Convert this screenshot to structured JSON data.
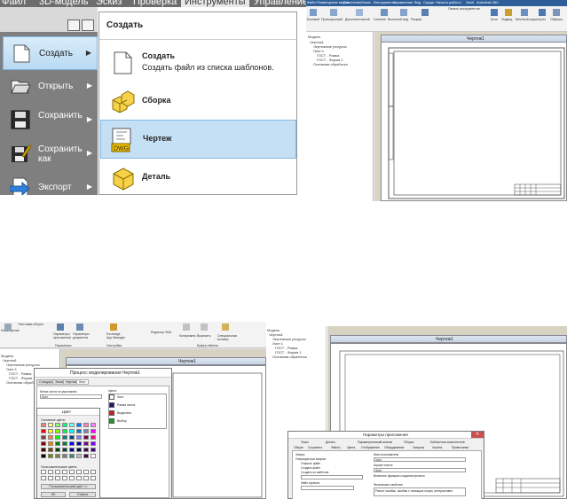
{
  "panel1": {
    "ribbon_tabs": [
      "Файл",
      "3D-модель",
      "Эскиз",
      "Проверка",
      "Инструменты",
      "Управление"
    ],
    "active_tab": "Инструменты",
    "file_menu": [
      {
        "label": "Создать",
        "selected": true
      },
      {
        "label": "Открыть",
        "selected": false
      },
      {
        "label": "Сохранить",
        "selected": false
      },
      {
        "label": "Сохранить как",
        "selected": false
      },
      {
        "label": "Экспорт",
        "selected": false
      }
    ],
    "submenu_title": "Создать",
    "submenu_items": [
      {
        "title": "Создать",
        "desc": "Создать файл из списка шаблонов."
      },
      {
        "title": "Сборка",
        "desc": ""
      },
      {
        "title": "Чертеж",
        "desc": "",
        "selected": true
      },
      {
        "title": "Деталь",
        "desc": ""
      }
    ],
    "dwg_badge": "DWG"
  },
  "panel2": {
    "tabs": [
      "Файл",
      "Размещение видов",
      "Пояснения",
      "Эскиз",
      "Инструменты",
      "Управление",
      "Вид",
      "Среда",
      "Начало работы",
      "Vault",
      "Autodesk 360"
    ],
    "ribbon_labels": [
      "Базовый",
      "Проекционный",
      "Дополнительный",
      "Сечение",
      "Выносной вид",
      "Разрыв",
      "Панель инструментов",
      "Блок",
      "Подвид",
      "Местный разрез",
      "Срез",
      "Обрезка"
    ],
    "browser_items": [
      "Модель",
      "Чертеж1",
      "Чертежные ресурсы",
      "Лист:1",
      "ГОСТ - Рамка",
      "ГОСТ - Форма 1",
      "Основная обработка"
    ],
    "sheet_title": "Чертеж1"
  },
  "panel3": {
    "ribbon_labels": [
      "Размещение",
      "Текстовая сборка",
      "Параметры приложения",
      "Параметры документа",
      "Exchange App Manager",
      "Редактор VBA",
      "Копировать",
      "Вырезать",
      "Специальная вставка",
      "Параметры",
      "Настройка",
      "Буфер обмена"
    ],
    "browser_items": [
      "Модель",
      "Чертеж1",
      "Чертежные ресурсы",
      "Лист:1",
      "ГОСТ - Рамка",
      "ГОСТ - Форма 1",
      "Основная обработка"
    ],
    "sheet_title": "Чертеж1",
    "dialog_title": "Процесс моделирования Чертеж1",
    "dialog_tabs": [
      "Стандарт",
      "Эскиз",
      "Чертеж",
      "Лист"
    ],
    "field_label": "Метка листа по умолчанию",
    "field_value": "Лист",
    "colors_header": "Цвета",
    "colors": [
      {
        "name": "Лист",
        "hex": "#ffffff"
      },
      {
        "name": "Рамка листа",
        "hex": "#1a1a6e"
      },
      {
        "name": "Выделить",
        "hex": "#d01f1f"
      },
      {
        "name": "Выбор",
        "hex": "#1f9e2a"
      }
    ],
    "color_dialog_title": "Цвет",
    "basic_colors_label": "Основные цвета:",
    "custom_colors_label": "Пользовательские цвета:",
    "define_button": "Пользовательский цвет >>",
    "ok_button": "ОК",
    "cancel_button": "Отмена"
  },
  "panel4": {
    "browser_items": [
      "Модель",
      "Чертеж1",
      "Чертежные ресурсы",
      "Лист:1",
      "ГОСТ - Рамка",
      "ГОСТ - Форма 1",
      "Основная обработка"
    ],
    "sheet_title": "Чертеж1",
    "dialog_title": "Параметры приложения",
    "tabs_row1": [
      "Эскиз",
      "Деталь",
      "Параметрический анализ",
      "Сборка",
      "Библиотека компонентов"
    ],
    "tabs_row2": [
      "Общие",
      "Сохранить",
      "Файлы",
      "Цвета",
      "Отображение",
      "Оборудование",
      "Запросы",
      "Чертеж",
      "Примечания"
    ],
    "left_labels": [
      "Запуск",
      "Операция при запуске",
      "Открыть файл",
      "Создать файл",
      "Создать из шаблона",
      "Файл проекта"
    ],
    "right_labels": [
      "Имя пользователя",
      "Шрифт текста",
      "Включить функцию создания проекта",
      "Физические свойства",
      "Расчет ошибки, ошибки с помощью опции, интерактивно"
    ],
    "user_name": "User",
    "text_font": "Arial"
  }
}
